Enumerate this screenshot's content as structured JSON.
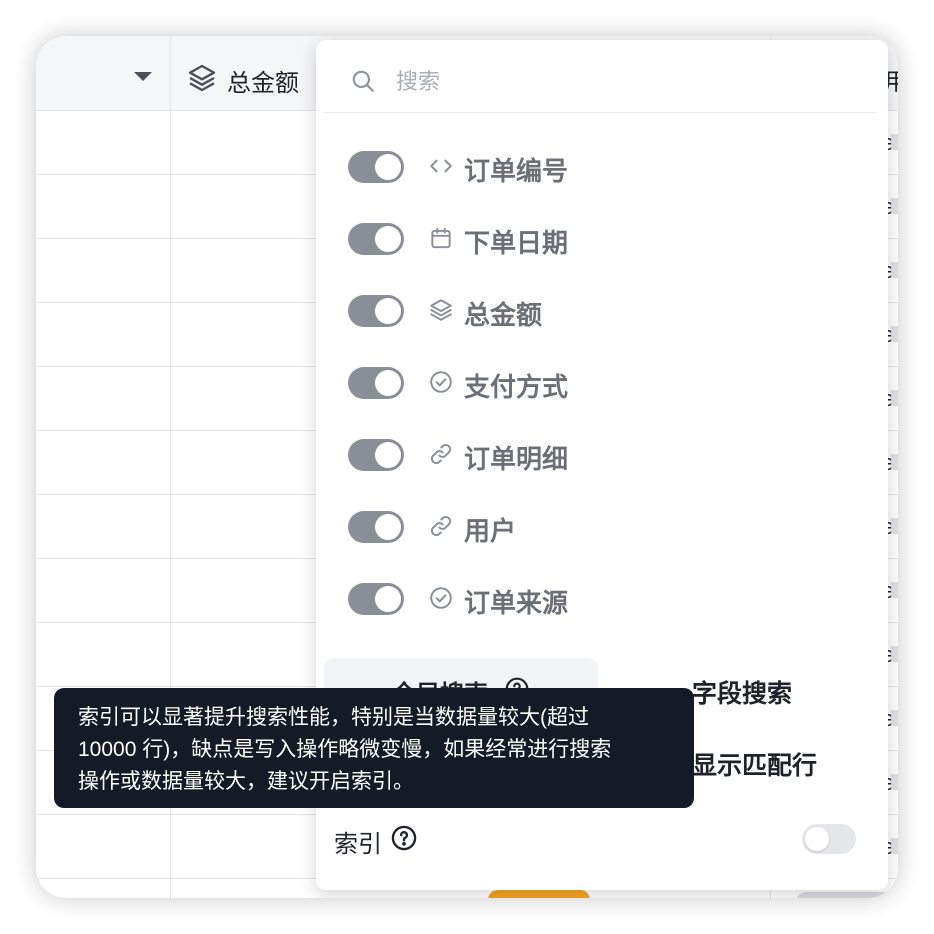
{
  "table": {
    "visible_header": {
      "label": "总金额",
      "icon": "layers-icon"
    },
    "right_peek_header": "用",
    "right_peek_cell": "e"
  },
  "field_panel": {
    "search": {
      "placeholder": "搜索",
      "value": ""
    },
    "fields": [
      {
        "label": "订单编号",
        "icon": "code-icon",
        "visible": true
      },
      {
        "label": "下单日期",
        "icon": "calendar-icon",
        "visible": true
      },
      {
        "label": "总金额",
        "icon": "layers-icon",
        "visible": true
      },
      {
        "label": "支付方式",
        "icon": "check-circle-icon",
        "visible": true
      },
      {
        "label": "订单明细",
        "icon": "link-icon",
        "visible": true
      },
      {
        "label": "用户",
        "icon": "link-icon",
        "visible": true
      },
      {
        "label": "订单来源",
        "icon": "check-circle-icon",
        "visible": true
      }
    ],
    "search_mode": {
      "global_label": "全局搜索",
      "field_label": "字段搜索",
      "selected": "global"
    },
    "show_matching_rows_label": "显示匹配行",
    "index": {
      "label": "索引",
      "enabled": false
    }
  },
  "tooltip": {
    "text": "索引可以显著提升搜索性能，特别是当数据量较大(超过\n10000 行)，缺点是写入操作略微变慢，如果经常进行搜索\n操作或数据量较大，建议开启索引。"
  },
  "colors": {
    "toggle_on": "#8a8e96",
    "toggle_off": "#e4e6ea",
    "tooltip_bg": "#141b26",
    "accent_orange": "#f5a623"
  }
}
